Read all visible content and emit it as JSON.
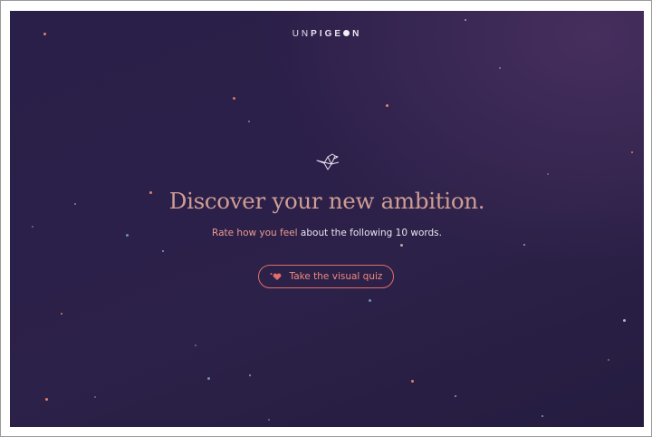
{
  "header": {
    "logo_light_1": "UN",
    "logo_bold": "PIGE",
    "logo_light_2": "N"
  },
  "hero": {
    "headline": "Discover your new ambition.",
    "subline_accent": "Rate how you feel",
    "subline_rest": " about the following 10 words.",
    "cta_label": "Take the visual quiz"
  },
  "icons": {
    "logo_mark": "pigeon-icon",
    "cta_icon": "heart-icon"
  },
  "colors": {
    "background": "#2a1f48",
    "headline": "#cf9d93",
    "accent": "#ec9a90",
    "button_border": "#e26d6a"
  }
}
